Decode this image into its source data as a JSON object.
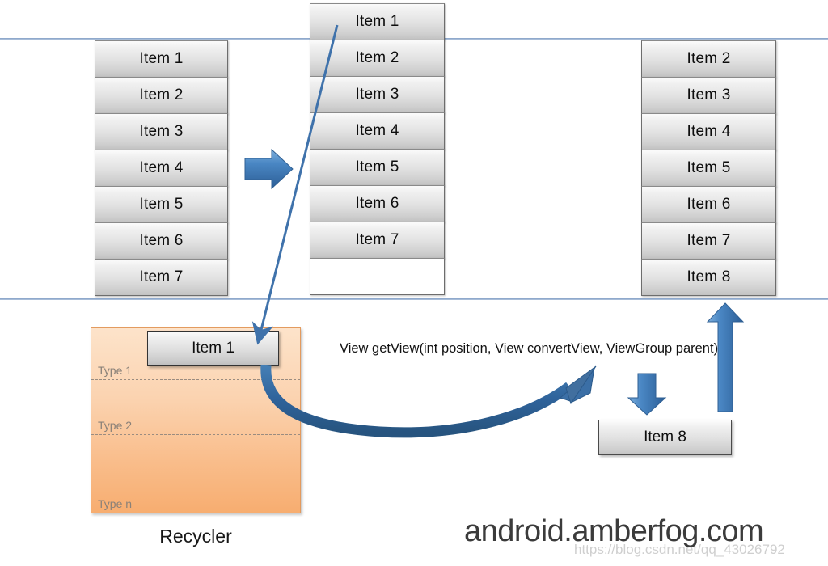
{
  "diagram": {
    "title_watermark": "android.amberfog.com",
    "blog_watermark": "https://blog.csdn.net/qq_43026792",
    "method_signature": "View getView(int position, View convertView, ViewGroup parent)",
    "recycler_caption": "Recycler",
    "accent_color": "#3a6ea5",
    "guide_color": "#7f9cc4",
    "recycler_fill": "#f9bd8b",
    "cell_fill": "#dcdcdc"
  },
  "columns": {
    "left": {
      "name": "list-before-scroll",
      "cells": [
        {
          "label": "Item 1",
          "empty": false
        },
        {
          "label": "Item 2",
          "empty": false
        },
        {
          "label": "Item 3",
          "empty": false
        },
        {
          "label": "Item 4",
          "empty": false
        },
        {
          "label": "Item 5",
          "empty": false
        },
        {
          "label": "Item 6",
          "empty": false
        },
        {
          "label": "Item 7",
          "empty": false
        }
      ]
    },
    "middle": {
      "name": "list-scrolling",
      "cells": [
        {
          "label": "Item 1",
          "empty": false
        },
        {
          "label": "Item 2",
          "empty": false
        },
        {
          "label": "Item 3",
          "empty": false
        },
        {
          "label": "Item 4",
          "empty": false
        },
        {
          "label": "Item 5",
          "empty": false
        },
        {
          "label": "Item 6",
          "empty": false
        },
        {
          "label": "Item 7",
          "empty": false
        },
        {
          "label": "",
          "empty": true
        }
      ]
    },
    "right": {
      "name": "list-after-scroll",
      "cells": [
        {
          "label": "Item 2",
          "empty": false
        },
        {
          "label": "Item 3",
          "empty": false
        },
        {
          "label": "Item 4",
          "empty": false
        },
        {
          "label": "Item 5",
          "empty": false
        },
        {
          "label": "Item 6",
          "empty": false
        },
        {
          "label": "Item 7",
          "empty": false
        },
        {
          "label": "Item 8",
          "empty": false
        }
      ]
    }
  },
  "recycler": {
    "caption": "Recycler",
    "types": [
      {
        "label": "Type 1"
      },
      {
        "label": "Type 2"
      },
      {
        "label": "Type n"
      }
    ],
    "held_view_label": "Item 1"
  },
  "detached_view": {
    "label": "Item 8"
  },
  "arrows": [
    {
      "name": "scroll-right-arrow",
      "kind": "right"
    },
    {
      "name": "recycle-diagonal-arrow",
      "kind": "diagonal-down"
    },
    {
      "name": "convertview-curve-arrow",
      "kind": "curve"
    },
    {
      "name": "bind-down-arrow",
      "kind": "down"
    },
    {
      "name": "attach-up-arrow",
      "kind": "up"
    }
  ]
}
